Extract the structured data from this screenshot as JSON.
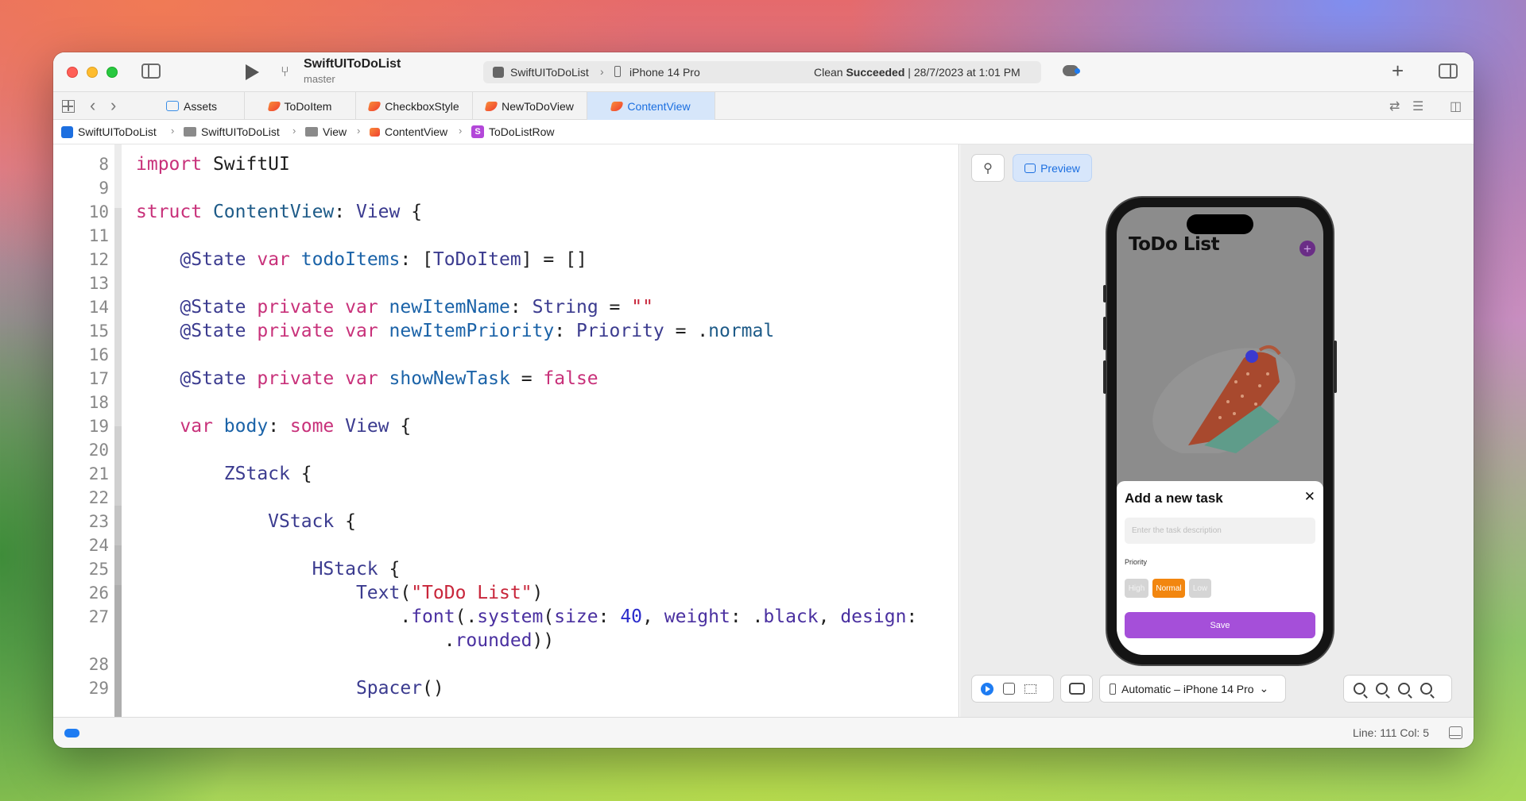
{
  "window": {
    "project_name": "SwiftUIToDoList",
    "branch": "master"
  },
  "activity": {
    "scheme": "SwiftUIToDoList",
    "device": "iPhone 14 Pro",
    "status_prefix": "Clean ",
    "status_bold": "Succeeded",
    "status_suffix": " | 28/7/2023 at 1:01 PM"
  },
  "tabs": [
    {
      "label": "Assets",
      "icon": "assets-icon",
      "active": false
    },
    {
      "label": "ToDoItem",
      "icon": "swift-file-icon",
      "active": false
    },
    {
      "label": "CheckboxStyle",
      "icon": "swift-file-icon",
      "active": false
    },
    {
      "label": "NewToDoView",
      "icon": "swift-file-icon",
      "active": false
    },
    {
      "label": "ContentView",
      "icon": "swift-file-icon",
      "active": true
    }
  ],
  "breadcrumb": [
    "SwiftUIToDoList",
    "SwiftUIToDoList",
    "View",
    "ContentView",
    "ToDoListRow"
  ],
  "editor": {
    "lines": [
      {
        "n": "8",
        "html": "<span class='kw'>import</span> SwiftUI"
      },
      {
        "n": "9",
        "html": ""
      },
      {
        "n": "10",
        "html": "<span class='kw'>struct</span> <span class='typ'>ContentView</span>: <span class='tp2'>View</span> {"
      },
      {
        "n": "11",
        "html": ""
      },
      {
        "n": "12",
        "html": "    <span class='tp2'>@State</span> <span class='kw'>var</span> <span class='var'>todoItems</span>: [<span class='tp2'>ToDoItem</span>] = []"
      },
      {
        "n": "13",
        "html": ""
      },
      {
        "n": "14",
        "html": "    <span class='tp2'>@State</span> <span class='kw'>private</span> <span class='kw'>var</span> <span class='var'>newItemName</span>: <span class='tp2'>String</span> = <span class='str'>\"\"</span>"
      },
      {
        "n": "15",
        "html": "    <span class='tp2'>@State</span> <span class='kw'>private</span> <span class='kw'>var</span> <span class='var'>newItemPriority</span>: <span class='tp2'>Priority</span> = .<span class='typ'>normal</span>"
      },
      {
        "n": "16",
        "html": ""
      },
      {
        "n": "17",
        "html": "    <span class='tp2'>@State</span> <span class='kw'>private</span> <span class='kw'>var</span> <span class='var'>showNewTask</span> = <span class='kw'>false</span>"
      },
      {
        "n": "18",
        "html": ""
      },
      {
        "n": "19",
        "html": "    <span class='kw'>var</span> <span class='var'>body</span>: <span class='kw'>some</span> <span class='tp2'>View</span> {"
      },
      {
        "n": "20",
        "html": ""
      },
      {
        "n": "21",
        "html": "        <span class='tp2'>ZStack</span> {"
      },
      {
        "n": "22",
        "html": ""
      },
      {
        "n": "23",
        "html": "            <span class='tp2'>VStack</span> {"
      },
      {
        "n": "24",
        "html": ""
      },
      {
        "n": "25",
        "html": "                <span class='tp2'>HStack</span> {"
      },
      {
        "n": "26",
        "html": "                    <span class='tp2'>Text</span>(<span class='str'>\"ToDo List\"</span>)"
      },
      {
        "n": "27",
        "html": "                        .<span class='prop'>font</span>(.<span class='prop'>system</span>(<span class='prop'>size</span>: <span class='num'>40</span>, <span class='prop'>weight</span>: .<span class='prop'>black</span>, <span class='prop'>design</span>:"
      },
      {
        "n": "",
        "html": "                            .<span class='prop'>rounded</span>))"
      },
      {
        "n": "28",
        "html": ""
      },
      {
        "n": "29",
        "html": "                    <span class='tp2'>Spacer</span>()"
      }
    ]
  },
  "preview": {
    "preview_label": "Preview",
    "app_title": "ToDo List",
    "sheet_title": "Add a new task",
    "close_glyph": "✕",
    "input_placeholder": "Enter the task description",
    "priority_label": "Priority",
    "priority_options": [
      {
        "label": "High",
        "selected": false
      },
      {
        "label": "Normal",
        "selected": true
      },
      {
        "label": "Low",
        "selected": false
      }
    ],
    "selected_color": "#f2860f",
    "save_label": "Save",
    "save_color": "#a54fd9",
    "device_selector": "Automatic – iPhone 14 Pro"
  },
  "statusbar": {
    "line_col": "Line: 111  Col: 5"
  }
}
